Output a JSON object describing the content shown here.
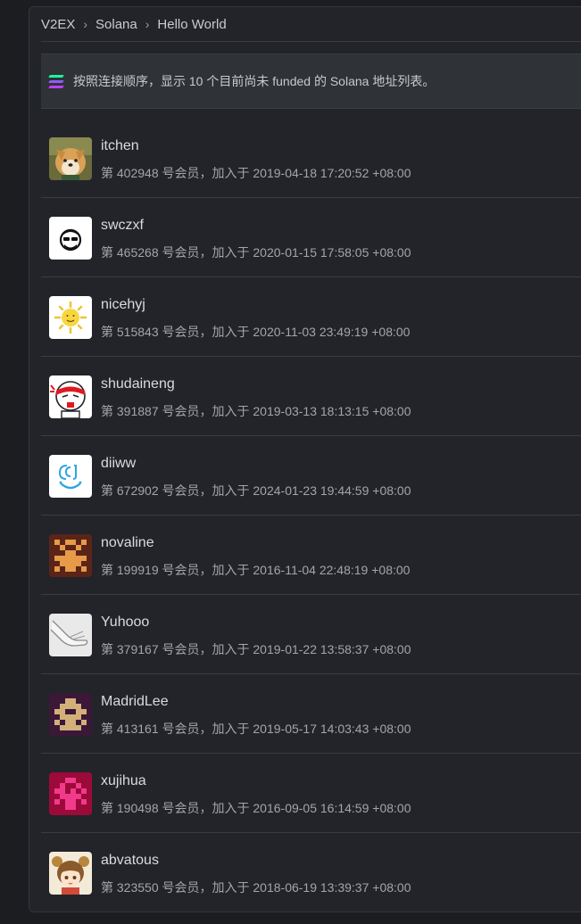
{
  "breadcrumb": {
    "site": "V2EX",
    "separator": "›",
    "node": "Solana",
    "title": "Hello World"
  },
  "notice": {
    "text": "按照连接顺序，显示 10 个目前尚未 funded 的 Solana 地址列表。"
  },
  "members": [
    {
      "username": "itchen",
      "meta": "第 402948 号会员，加入于 2019-04-18 17:20:52 +08:00"
    },
    {
      "username": "swczxf",
      "meta": "第 465268 号会员，加入于 2020-01-15 17:58:05 +08:00"
    },
    {
      "username": "nicehyj",
      "meta": "第 515843 号会员，加入于 2020-11-03 23:49:19 +08:00"
    },
    {
      "username": "shudaineng",
      "meta": "第 391887 号会员，加入于 2019-03-13 18:13:15 +08:00"
    },
    {
      "username": "diiww",
      "meta": "第 672902 号会员，加入于 2024-01-23 19:44:59 +08:00"
    },
    {
      "username": "novaline",
      "meta": "第 199919 号会员，加入于 2016-11-04 22:48:19 +08:00"
    },
    {
      "username": "Yuhooo",
      "meta": "第 379167 号会员，加入于 2019-01-22 13:58:37 +08:00"
    },
    {
      "username": "MadridLee",
      "meta": "第 413161 号会员，加入于 2019-05-17 14:03:43 +08:00"
    },
    {
      "username": "xujihua",
      "meta": "第 190498 号会员，加入于 2016-09-05 16:14:59 +08:00"
    },
    {
      "username": "abvatous",
      "meta": "第 323550 号会员，加入于 2018-06-19 13:39:37 +08:00"
    }
  ],
  "colors": {
    "background": "#1c1d21",
    "box": "#232429",
    "notice_bg": "#2f3237",
    "text": "#d9dbe0",
    "muted": "#a3a5ab"
  }
}
